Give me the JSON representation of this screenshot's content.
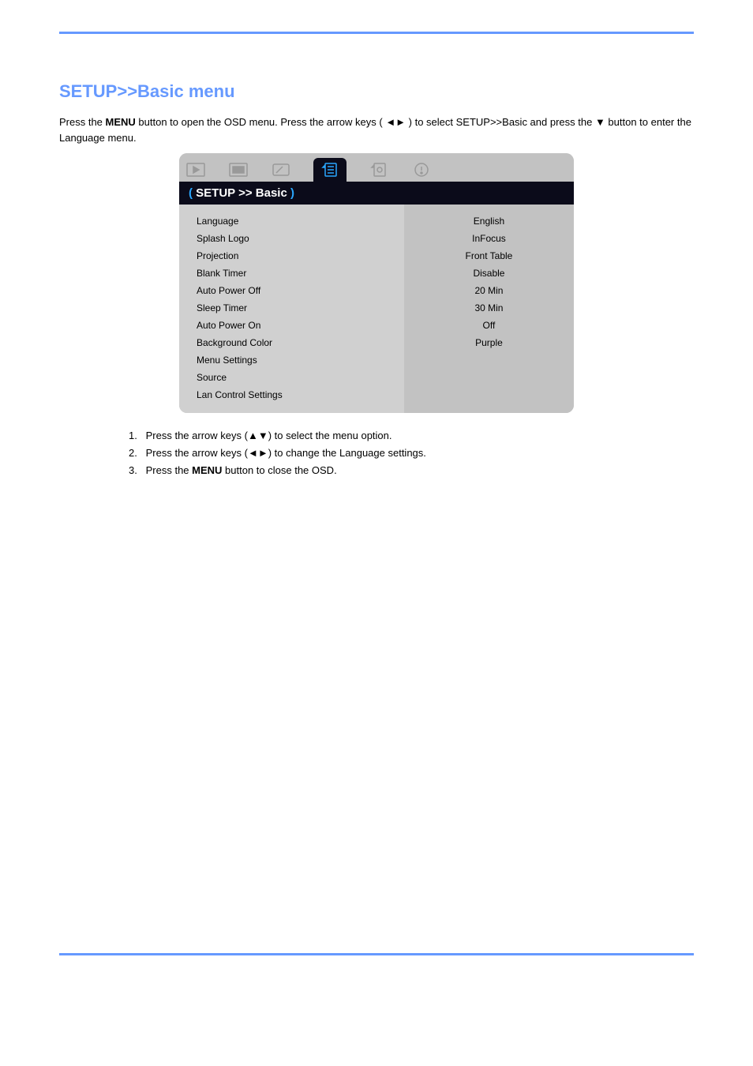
{
  "header": {
    "title": "SETUP>>Basic menu",
    "intro_prefix": "Press the ",
    "intro_mid": "MENU",
    "intro_mid2": " button to open the OSD menu. Press the arrow keys ( ",
    "intro_arrows": "◄►",
    "intro_suffix": " ) to select SETUP>>Basic and press the ",
    "intro_down": "▼",
    "intro_end": " button to enter the Language menu."
  },
  "osd": {
    "breadcrumb": "SETUP >> Basic",
    "tabs": [
      "picture-basic",
      "picture-advanced",
      "display",
      "setup-basic",
      "setup-advanced",
      "status"
    ],
    "selected_tab_index": 3,
    "items": [
      {
        "label": "Language",
        "value": "English"
      },
      {
        "label": "Splash Logo",
        "value": "InFocus"
      },
      {
        "label": "Projection",
        "value": "Front Table"
      },
      {
        "label": "Blank Timer",
        "value": "Disable"
      },
      {
        "label": "Auto Power Off",
        "value": "20 Min"
      },
      {
        "label": "Sleep Timer",
        "value": "30 Min"
      },
      {
        "label": "Auto Power On",
        "value": "Off"
      },
      {
        "label": "Background Color",
        "value": "Purple"
      },
      {
        "label": "Menu Settings",
        "value": ""
      },
      {
        "label": "Source",
        "value": ""
      },
      {
        "label": "Lan Control Settings",
        "value": ""
      }
    ]
  },
  "instructions": {
    "step1_a": "Press the arrow keys (",
    "step1_arrows": "▲▼",
    "step1_b": ") to select the menu option.",
    "step2_a": "Press the arrow keys (",
    "step2_arrows": "◄►",
    "step2_b": ") to change the Language settings.",
    "step3_a": "Press the ",
    "step3_menu": "MENU",
    "step3_b": " button to close the OSD."
  }
}
